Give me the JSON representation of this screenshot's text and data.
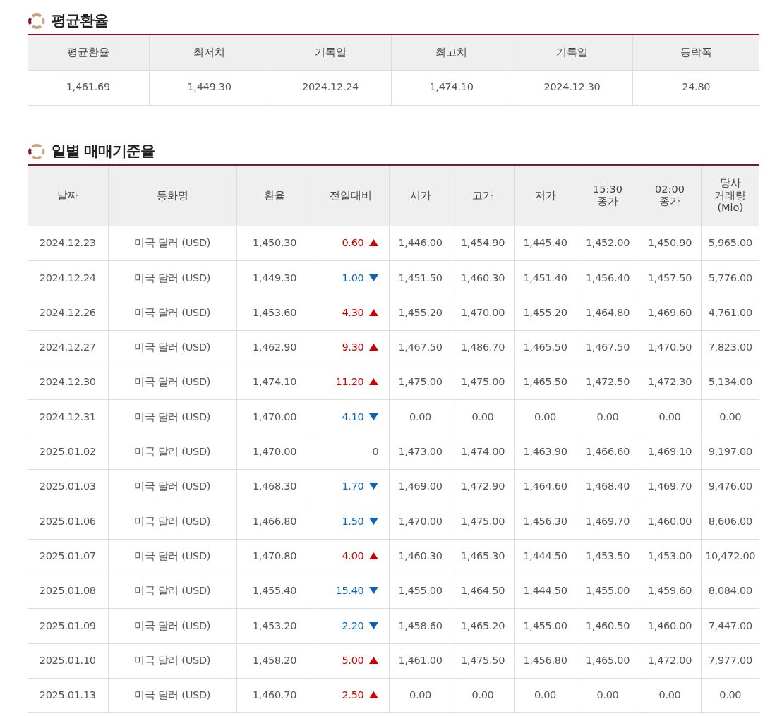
{
  "average_section": {
    "title": "평균환율",
    "columns": [
      "평균환율",
      "최저치",
      "기록일",
      "최고치",
      "기록일",
      "등락폭"
    ],
    "row": [
      "1,461.69",
      "1,449.30",
      "2024.12.24",
      "1,474.10",
      "2024.12.30",
      "24.80"
    ]
  },
  "daily_section": {
    "title": "일별 매매기준율",
    "columns": [
      "날짜",
      "통화명",
      "환율",
      "전일대비",
      "시가",
      "고가",
      "저가",
      "15:30\n종가",
      "02:00\n종가",
      "당사\n거래량\n(Mio)"
    ],
    "rows": [
      {
        "date": "2024.12.23",
        "currency": "미국 달러 (USD)",
        "rate": "1,450.30",
        "change": "0.60",
        "kind": "up",
        "open": "1,446.00",
        "high": "1,454.90",
        "low": "1,445.40",
        "close_1530": "1,452.00",
        "close_0200": "1,450.90",
        "volume": "5,965.00"
      },
      {
        "date": "2024.12.24",
        "currency": "미국 달러 (USD)",
        "rate": "1,449.30",
        "change": "1.00",
        "kind": "down",
        "open": "1,451.50",
        "high": "1,460.30",
        "low": "1,451.40",
        "close_1530": "1,456.40",
        "close_0200": "1,457.50",
        "volume": "5,776.00"
      },
      {
        "date": "2024.12.26",
        "currency": "미국 달러 (USD)",
        "rate": "1,453.60",
        "change": "4.30",
        "kind": "up",
        "open": "1,455.20",
        "high": "1,470.00",
        "low": "1,455.20",
        "close_1530": "1,464.80",
        "close_0200": "1,469.60",
        "volume": "4,761.00"
      },
      {
        "date": "2024.12.27",
        "currency": "미국 달러 (USD)",
        "rate": "1,462.90",
        "change": "9.30",
        "kind": "up",
        "open": "1,467.50",
        "high": "1,486.70",
        "low": "1,465.50",
        "close_1530": "1,467.50",
        "close_0200": "1,470.50",
        "volume": "7,823.00"
      },
      {
        "date": "2024.12.30",
        "currency": "미국 달러 (USD)",
        "rate": "1,474.10",
        "change": "11.20",
        "kind": "up",
        "open": "1,475.00",
        "high": "1,475.00",
        "low": "1,465.50",
        "close_1530": "1,472.50",
        "close_0200": "1,472.30",
        "volume": "5,134.00"
      },
      {
        "date": "2024.12.31",
        "currency": "미국 달러 (USD)",
        "rate": "1,470.00",
        "change": "4.10",
        "kind": "down",
        "open": "0.00",
        "high": "0.00",
        "low": "0.00",
        "close_1530": "0.00",
        "close_0200": "0.00",
        "volume": "0.00"
      },
      {
        "date": "2025.01.02",
        "currency": "미국 달러 (USD)",
        "rate": "1,470.00",
        "change": "0",
        "kind": "flat",
        "open": "1,473.00",
        "high": "1,474.00",
        "low": "1,463.90",
        "close_1530": "1,466.60",
        "close_0200": "1,469.10",
        "volume": "9,197.00"
      },
      {
        "date": "2025.01.03",
        "currency": "미국 달러 (USD)",
        "rate": "1,468.30",
        "change": "1.70",
        "kind": "down",
        "open": "1,469.00",
        "high": "1,472.90",
        "low": "1,464.60",
        "close_1530": "1,468.40",
        "close_0200": "1,469.70",
        "volume": "9,476.00"
      },
      {
        "date": "2025.01.06",
        "currency": "미국 달러 (USD)",
        "rate": "1,466.80",
        "change": "1.50",
        "kind": "down",
        "open": "1,470.00",
        "high": "1,475.00",
        "low": "1,456.30",
        "close_1530": "1,469.70",
        "close_0200": "1,460.00",
        "volume": "8,606.00"
      },
      {
        "date": "2025.01.07",
        "currency": "미국 달러 (USD)",
        "rate": "1,470.80",
        "change": "4.00",
        "kind": "up",
        "open": "1,460.30",
        "high": "1,465.30",
        "low": "1,444.50",
        "close_1530": "1,453.50",
        "close_0200": "1,453.00",
        "volume": "10,472.00"
      },
      {
        "date": "2025.01.08",
        "currency": "미국 달러 (USD)",
        "rate": "1,455.40",
        "change": "15.40",
        "kind": "down",
        "open": "1,455.00",
        "high": "1,464.50",
        "low": "1,444.50",
        "close_1530": "1,455.00",
        "close_0200": "1,459.60",
        "volume": "8,084.00"
      },
      {
        "date": "2025.01.09",
        "currency": "미국 달러 (USD)",
        "rate": "1,453.20",
        "change": "2.20",
        "kind": "down",
        "open": "1,458.60",
        "high": "1,465.20",
        "low": "1,455.00",
        "close_1530": "1,460.50",
        "close_0200": "1,460.00",
        "volume": "7,447.00"
      },
      {
        "date": "2025.01.10",
        "currency": "미국 달러 (USD)",
        "rate": "1,458.20",
        "change": "5.00",
        "kind": "up",
        "open": "1,461.00",
        "high": "1,475.50",
        "low": "1,456.80",
        "close_1530": "1,465.00",
        "close_0200": "1,472.00",
        "volume": "7,977.00"
      },
      {
        "date": "2025.01.13",
        "currency": "미국 달러 (USD)",
        "rate": "1,460.70",
        "change": "2.50",
        "kind": "up",
        "open": "0.00",
        "high": "0.00",
        "low": "0.00",
        "close_1530": "0.00",
        "close_0200": "0.00",
        "volume": "0.00"
      }
    ]
  }
}
